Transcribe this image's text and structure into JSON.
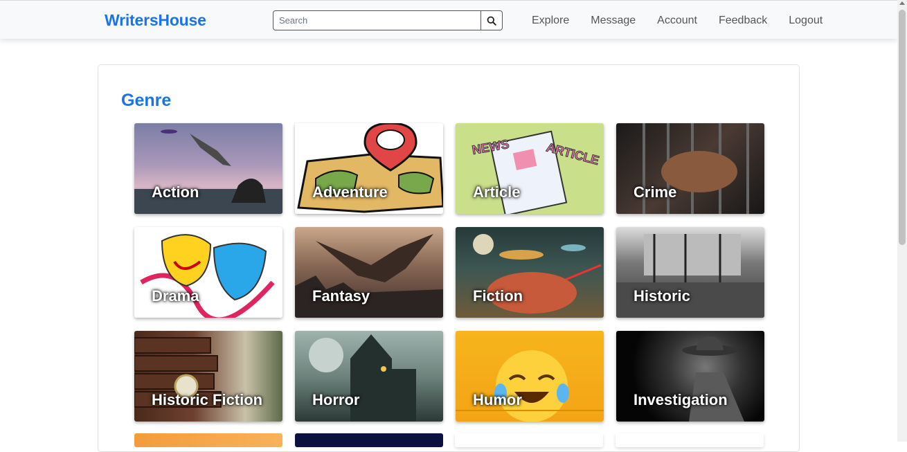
{
  "navbar": {
    "brand": "WritersHouse",
    "search_placeholder": "Search",
    "links": [
      "Explore",
      "Message",
      "Account",
      "Feedback",
      "Logout"
    ]
  },
  "main": {
    "section_title": "Genre",
    "genres": [
      "Action",
      "Adventure",
      "Article",
      "Crime",
      "Drama",
      "Fantasy",
      "Fiction",
      "Historic",
      "Historic Fiction",
      "Horror",
      "Humor",
      "Investigation"
    ]
  },
  "colors": {
    "brand": "#1a73e8",
    "nav_text": "#555555"
  }
}
